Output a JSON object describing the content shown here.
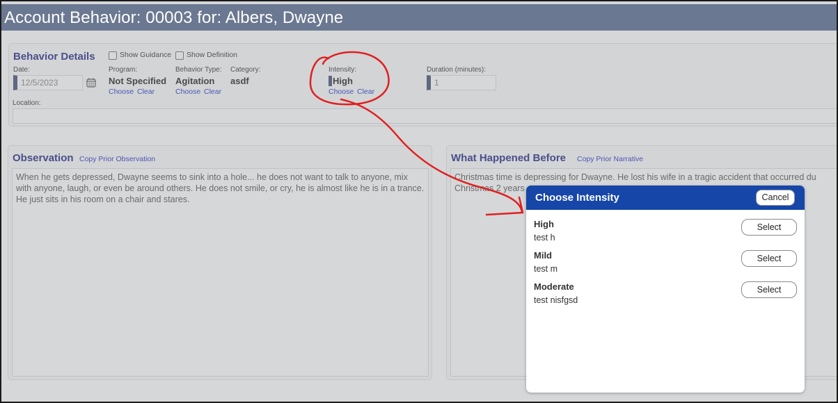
{
  "header": {
    "title": "Account Behavior: 00003 for: Albers, Dwayne"
  },
  "behavior_details": {
    "heading": "Behavior Details",
    "show_guidance": "Show Guidance",
    "show_definition": "Show Definition",
    "date_label": "Date:",
    "date_value": "12/5/2023",
    "program_label": "Program:",
    "program_value": "Not Specified",
    "behavior_type_label": "Behavior Type:",
    "behavior_type_value": "Agitation",
    "category_label": "Category:",
    "category_value": "asdf",
    "intensity_label": "Intensity:",
    "intensity_value": "High",
    "duration_label": "Duration (minutes):",
    "duration_value": "1",
    "location_label": "Location:",
    "choose": "Choose",
    "clear": "Clear"
  },
  "observation": {
    "heading": "Observation",
    "copy_link": "Copy Prior Observation",
    "text": "When he gets depressed, Dwayne seems to sink into a hole... he does not want to talk to anyone, mix with anyone, laugh, or even be around others.  He does not smile, or cry, he is almost like he is in a trance. He just sits in his room on a chair and stares."
  },
  "what_happened_before": {
    "heading": "What Happened Before",
    "copy_link": "Copy Prior Narrative",
    "text": "Christmas time is depressing for Dwayne.  He lost his wife in a tragic accident that occurred du Christmas 2 years"
  },
  "dialog": {
    "title": "Choose Intensity",
    "cancel_label": "Cancel",
    "select_label": "Select",
    "options": [
      {
        "name": "High",
        "desc": "test h"
      },
      {
        "name": "Mild",
        "desc": "test m"
      },
      {
        "name": "Moderate",
        "desc": "test nisfgsd"
      }
    ]
  },
  "colors": {
    "titlebar": "#6b7891",
    "panel_heading": "#4a4e8a",
    "link": "#4a57b4",
    "dialog_header": "#1646a8",
    "annotation": "#e02020"
  }
}
